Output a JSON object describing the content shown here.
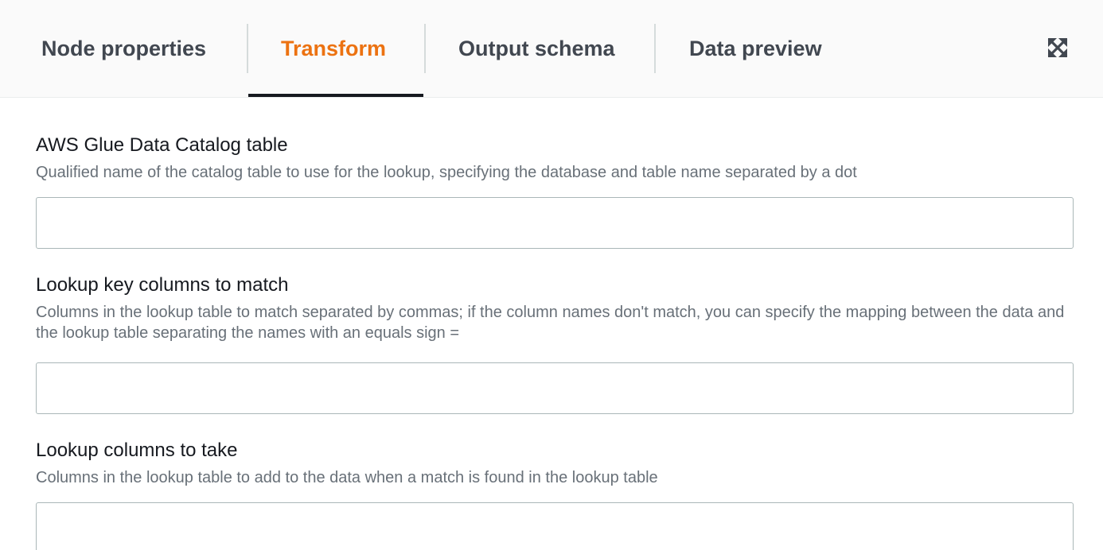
{
  "tabs": [
    {
      "label": "Node properties",
      "active": false
    },
    {
      "label": "Transform",
      "active": true
    },
    {
      "label": "Output schema",
      "active": false
    },
    {
      "label": "Data preview",
      "active": false
    }
  ],
  "expand_icon": "expand-icon",
  "colors": {
    "active_tab": "#ec7211",
    "indicator": "#16191f",
    "description": "#687078"
  },
  "fields": [
    {
      "label": "AWS Glue Data Catalog table",
      "description": "Qualified name of the catalog table to use for the lookup, specifying the database and table name separated by a dot",
      "value": "",
      "placeholder": ""
    },
    {
      "label": "Lookup key columns to match",
      "description": "Columns in the lookup table to match separated by commas; if the column names don't match, you can specify the mapping between the data and the lookup table separating the names with an equals sign =",
      "value": "",
      "placeholder": ""
    },
    {
      "label": "Lookup columns to take",
      "description": "Columns in the lookup table to add to the data when a match is found in the lookup table",
      "value": "",
      "placeholder": ""
    }
  ]
}
